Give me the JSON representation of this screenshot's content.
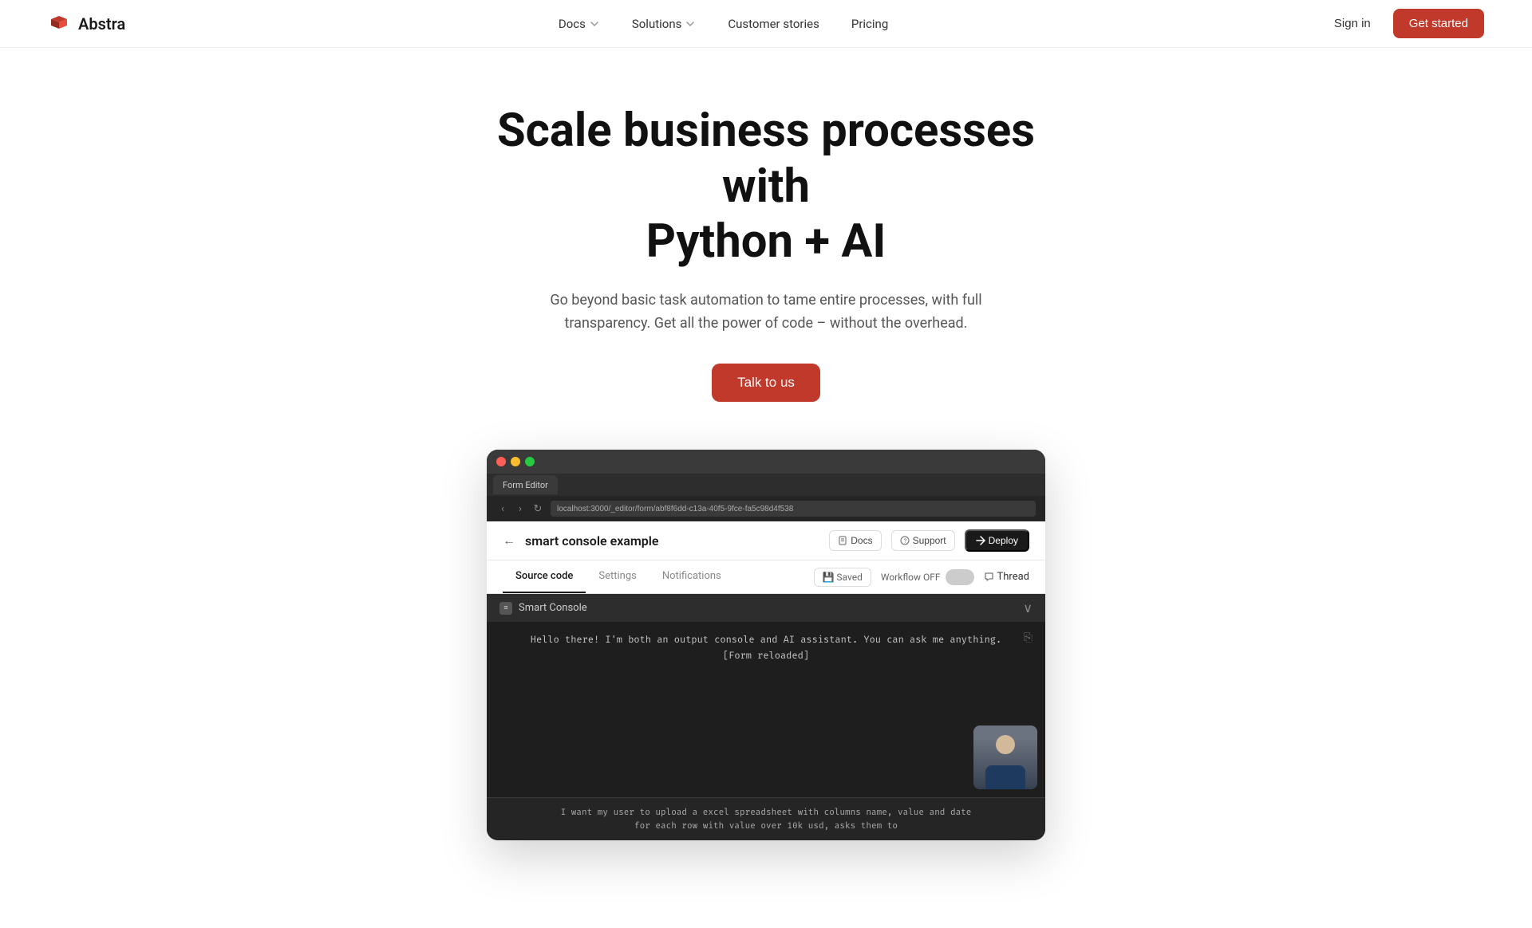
{
  "brand": {
    "name": "Abstra",
    "logo_alt": "Abstra logo"
  },
  "nav": {
    "docs_label": "Docs",
    "solutions_label": "Solutions",
    "customer_stories_label": "Customer stories",
    "pricing_label": "Pricing",
    "sign_in_label": "Sign in",
    "get_started_label": "Get started"
  },
  "hero": {
    "title_line1": "Scale business processes with",
    "title_line2": "Python + AI",
    "subtitle": "Go beyond basic task automation to tame entire processes, with full transparency. Get all the power of code – without the overhead.",
    "cta_label": "Talk to us"
  },
  "screenshot": {
    "tab_label": "Form Editor",
    "address": "localhost:3000/_editor/form/abf8f6dd-c13a-40f5-9fce-fa5c98d4f538",
    "app_title": "smart console example",
    "docs_btn": "Docs",
    "support_btn": "Support",
    "deploy_btn": "Deploy",
    "tab_source": "Source code",
    "tab_settings": "Settings",
    "tab_notifications": "Notifications",
    "saved_label": "Saved",
    "workflow_label": "Workflow OFF",
    "thread_label": "Thread",
    "console_title": "Smart Console",
    "console_message1": "Hello there! I'm both an output console and AI assistant. You can ask me anything.",
    "console_message2": "[Form reloaded]",
    "console_input1": "I want my user to upload a excel spreadsheet with columns name, value and date",
    "console_input2": "for each row with value over 10k usd, asks them to"
  },
  "colors": {
    "brand_red": "#c0392b",
    "nav_border": "#f0f0f0"
  }
}
